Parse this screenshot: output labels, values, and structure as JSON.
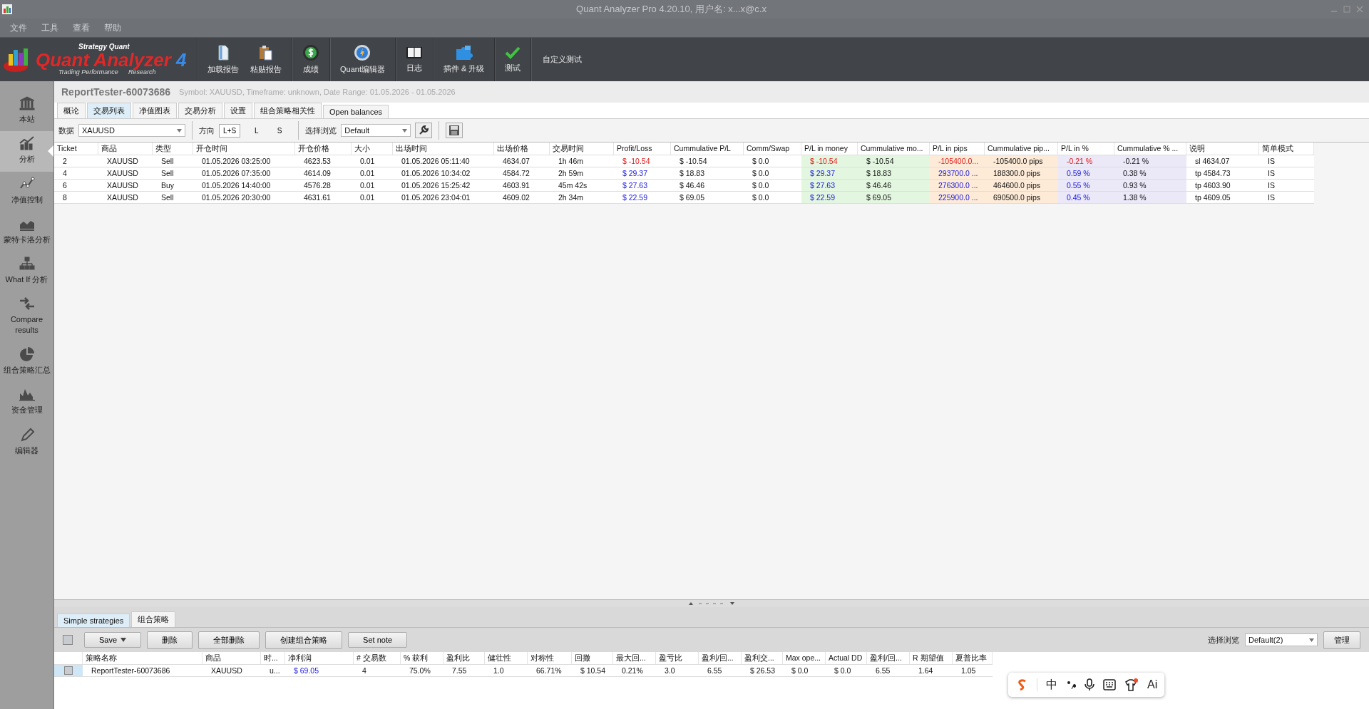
{
  "window": {
    "title": "Quant Analyzer Pro 4.20.10, 用户名: x...x@c.x"
  },
  "menu": [
    "文件",
    "工具",
    "查看",
    "帮助"
  ],
  "logo": {
    "brand": "Strategy Quant",
    "product": "Quant Analyzer",
    "version": "4",
    "tagline": "Trading Performance",
    "tagline_2": "Research"
  },
  "toolbar": [
    [
      {
        "label": "加载报告",
        "kind": "load"
      },
      {
        "label": "粘贴报告",
        "kind": "paste"
      }
    ],
    [
      {
        "label": "成绩",
        "kind": "score"
      }
    ],
    [
      {
        "label": "Quant编辑器",
        "kind": "editor"
      }
    ],
    [
      {
        "label": "日志",
        "kind": "log"
      }
    ],
    [
      {
        "label": "插件 & 升级",
        "kind": "plugin"
      }
    ],
    [
      {
        "label": "测试",
        "kind": "test"
      }
    ],
    [
      {
        "label": "自定义测试",
        "kind": "text"
      }
    ]
  ],
  "sidebar": [
    {
      "label": "本站",
      "kind": "bank",
      "selected": false
    },
    {
      "label": "分析",
      "kind": "analysis",
      "selected": true
    },
    {
      "label": "净值控制",
      "kind": "equity",
      "selected": false
    },
    {
      "label": "蒙特卡洛分析",
      "kind": "montecarlo",
      "selected": false
    },
    {
      "label": "What If 分析",
      "kind": "whatif",
      "selected": false
    },
    {
      "label": "Compare results",
      "kind": "compare",
      "selected": false
    },
    {
      "label": "组合策略汇总",
      "kind": "portfolio",
      "selected": false
    },
    {
      "label": "资金管理",
      "kind": "money",
      "selected": false
    },
    {
      "label": "编辑器",
      "kind": "editor",
      "selected": false
    }
  ],
  "report": {
    "title": "ReportTester-60073686",
    "subtitle": "Symbol: XAUUSD, Timeframe: unknown, Date Range: 01.05.2026 - 01.05.2026"
  },
  "tabs": [
    {
      "label": "概论",
      "selected": false
    },
    {
      "label": "交易列表",
      "selected": true
    },
    {
      "label": "净值图表",
      "selected": false
    },
    {
      "label": "交易分析",
      "selected": false
    },
    {
      "label": "设置",
      "selected": false
    },
    {
      "label": "组合策略相关性",
      "selected": false
    },
    {
      "label": "Open balances",
      "selected": false
    }
  ],
  "filters": {
    "data_label": "数据",
    "data_value": "XAUUSD",
    "direction_label": "方向",
    "directions": [
      {
        "label": "L+S",
        "selected": true
      },
      {
        "label": "L",
        "selected": false
      },
      {
        "label": "S",
        "selected": false
      }
    ],
    "view_label": "选择浏览",
    "view_value": "Default"
  },
  "trades": {
    "columns": [
      "Ticket",
      "商品",
      "类型",
      "开仓时间",
      "开仓价格",
      "大小",
      "出场时间",
      "出场价格",
      "交易时间",
      "Profit/Loss",
      "Cummulative P/L",
      "Comm/Swap",
      "P/L in money",
      "Cummulative mo...",
      "P/L in pips",
      "Cummulative pip...",
      "P/L in %",
      "Cummulative % ...",
      "说明",
      "简单模式"
    ],
    "rows": [
      {
        "loss": true,
        "cells": [
          "2",
          "XAUUSD",
          "Sell",
          "01.05.2026 03:25:00",
          "4623.53",
          "0.01",
          "01.05.2026 05:11:40",
          "4634.07",
          "1h 46m",
          "$ -10.54",
          "$ -10.54",
          "$ 0.0",
          "$ -10.54",
          "$ -10.54",
          "-105400.0...",
          "-105400.0 pips",
          "-0.21 %",
          "-0.21 %",
          "sl 4634.07",
          "IS"
        ]
      },
      {
        "loss": false,
        "cells": [
          "4",
          "XAUUSD",
          "Sell",
          "01.05.2026 07:35:00",
          "4614.09",
          "0.01",
          "01.05.2026 10:34:02",
          "4584.72",
          "2h 59m",
          "$ 29.37",
          "$ 18.83",
          "$ 0.0",
          "$ 29.37",
          "$ 18.83",
          "293700.0 ...",
          "188300.0 pips",
          "0.59 %",
          "0.38 %",
          "tp 4584.73",
          "IS"
        ]
      },
      {
        "loss": false,
        "cells": [
          "6",
          "XAUUSD",
          "Buy",
          "01.05.2026 14:40:00",
          "4576.28",
          "0.01",
          "01.05.2026 15:25:42",
          "4603.91",
          "45m 42s",
          "$ 27.63",
          "$ 46.46",
          "$ 0.0",
          "$ 27.63",
          "$ 46.46",
          "276300.0 ...",
          "464600.0 pips",
          "0.55 %",
          "0.93 %",
          "tp 4603.90",
          "IS"
        ]
      },
      {
        "loss": false,
        "cells": [
          "8",
          "XAUUSD",
          "Sell",
          "01.05.2026 20:30:00",
          "4631.61",
          "0.01",
          "01.05.2026 23:04:01",
          "4609.02",
          "2h 34m",
          "$ 22.59",
          "$ 69.05",
          "$ 0.0",
          "$ 22.59",
          "$ 69.05",
          "225900.0 ...",
          "690500.0 pips",
          "0.45 %",
          "1.38 %",
          "tp 4609.05",
          "IS"
        ]
      }
    ]
  },
  "bottom": {
    "tabs": [
      {
        "label": "Simple strategies",
        "selected": true
      },
      {
        "label": "组合策略",
        "selected": false
      }
    ],
    "select_all": {
      "checked": false
    },
    "buttons": [
      {
        "label": "Save",
        "kind": "dropdown"
      },
      {
        "label": "删除",
        "kind": "plain"
      },
      {
        "label": "全部删除",
        "kind": "plain"
      },
      {
        "label": "创建组合策略",
        "kind": "plain"
      },
      {
        "label": "Set note",
        "kind": "plain"
      }
    ],
    "view_label": "选择浏览",
    "view_value": "Default(2)",
    "manage": "管理",
    "columns": [
      "策略名称",
      "商品",
      "时...",
      "净利润",
      "# 交易数",
      "% 获利",
      "盈利比",
      "健壮性",
      "对称性",
      "回撤",
      "最大回...",
      "盈亏比",
      "盈利/回...",
      "盈利交...",
      "Max ope...",
      "Actual DD",
      "盈利/回...",
      "R 期望值",
      "夏普比率"
    ],
    "rows": [
      {
        "checked": false,
        "cells": [
          "ReportTester-60073686",
          "XAUUSD",
          "u...",
          "$ 69.05",
          "4",
          "75.0%",
          "7.55",
          "1.0",
          "66.71%",
          "$ 10.54",
          "0.21%",
          "3.0",
          "6.55",
          "$ 26.53",
          "$ 0.0",
          "$ 0.0",
          "6.55",
          "1.64",
          "1.05"
        ]
      }
    ]
  },
  "ime": {
    "mode": "中",
    "ai": "Ai"
  }
}
